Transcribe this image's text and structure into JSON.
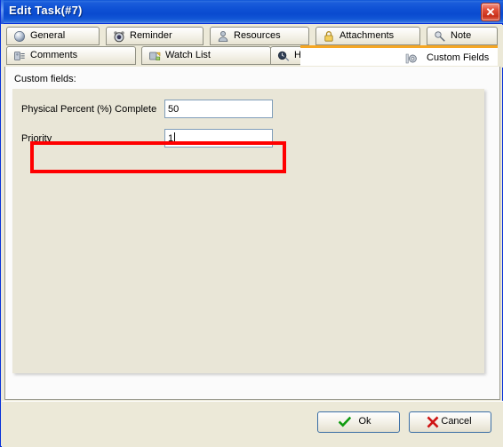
{
  "window": {
    "title": "Edit Task(#7)",
    "close_label": "✕",
    "close_icon": "close-icon",
    "titlebar_color": "#0a4bd0",
    "close_button_color": "#c8301a"
  },
  "tabs": {
    "row1": [
      {
        "label": "General",
        "icon": "sphere-icon"
      },
      {
        "label": "Reminder",
        "icon": "alarm-clock-icon"
      },
      {
        "label": "Resources",
        "icon": "person-icon"
      },
      {
        "label": "Attachments",
        "icon": "padlock-icon"
      },
      {
        "label": "Note",
        "icon": "pushpin-icon"
      }
    ],
    "row2": [
      {
        "label": "Comments",
        "icon": "comment-card-icon"
      },
      {
        "label": "Watch List",
        "icon": "watch-list-icon"
      },
      {
        "label": "History",
        "icon": "clock-icon"
      },
      {
        "label": "Custom Fields",
        "icon": "gear-icon",
        "active": true
      }
    ],
    "active_tab": "Custom Fields",
    "active_indicator_color": "#f5a623"
  },
  "content": {
    "section_label": "Custom fields:",
    "panel_color": "#e9e6d7",
    "fields": [
      {
        "label": "Physical Percent (%) Complete",
        "value": "50",
        "placeholder": "",
        "focused": false,
        "highlighted": false
      },
      {
        "label": "Priority",
        "value": "1",
        "placeholder": "",
        "focused": true,
        "highlighted": true
      }
    ],
    "highlight": {
      "color": "#ff0000",
      "target_field": "Priority"
    }
  },
  "footer": {
    "ok_label": "Ok",
    "ok_icon": "checkmark-icon",
    "ok_icon_color": "#109010",
    "cancel_label": "Cancel",
    "cancel_icon": "cross-icon",
    "cancel_icon_color": "#d01010"
  }
}
